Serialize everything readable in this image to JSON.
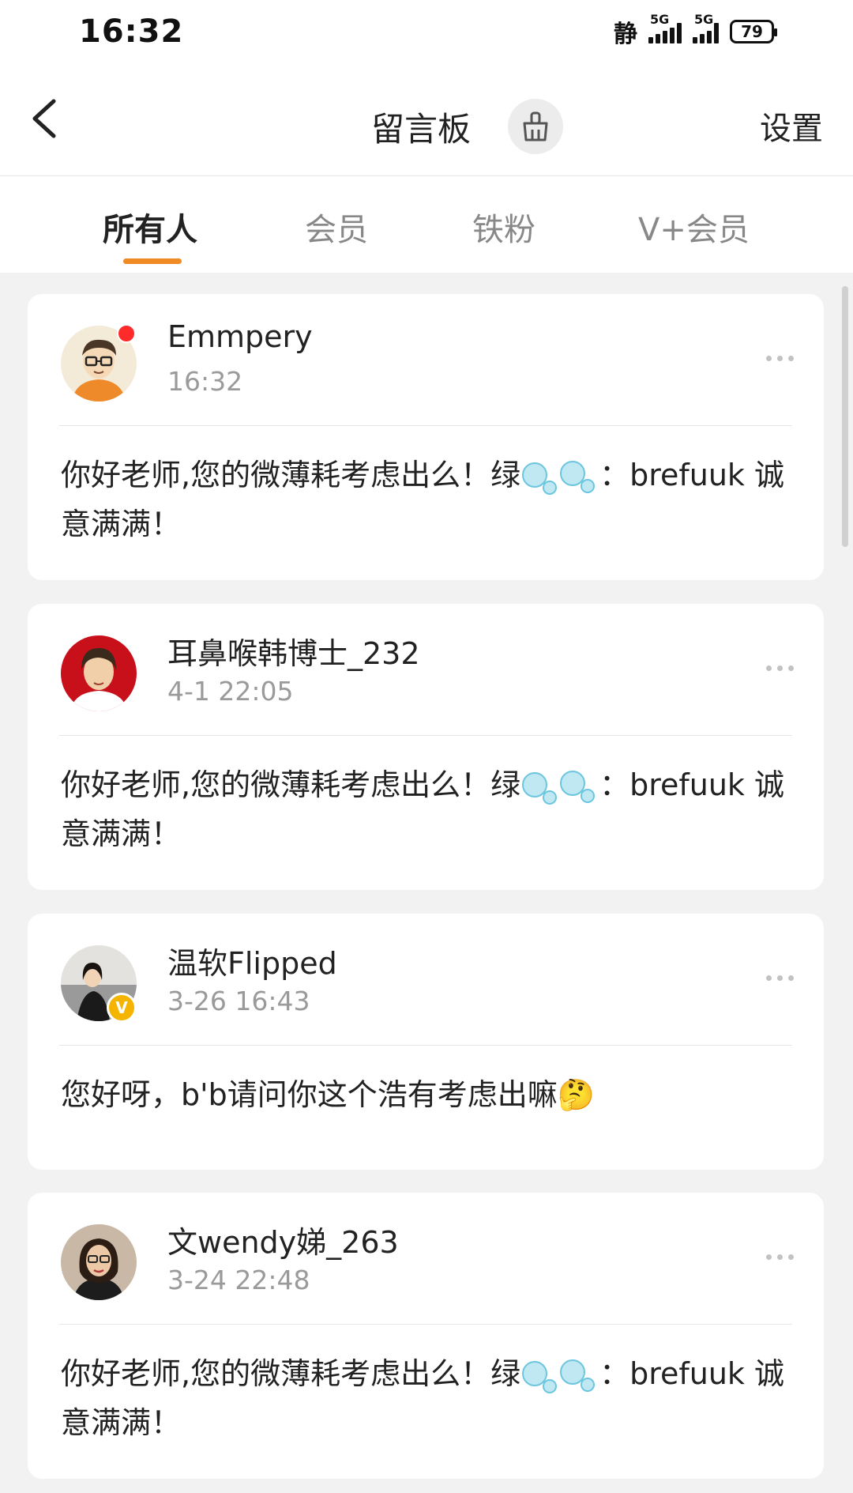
{
  "status_bar": {
    "time": "16:32",
    "mute_label": "静",
    "network1": "5G",
    "network2": "5G",
    "battery": "79"
  },
  "nav": {
    "title": "留言板",
    "settings_label": "设置",
    "back_icon": "chevron-left-icon",
    "clean_icon": "broom-icon"
  },
  "tabs": [
    {
      "label": "所有人",
      "active": true
    },
    {
      "label": "会员",
      "active": false
    },
    {
      "label": "铁粉",
      "active": false
    },
    {
      "label": "V+会员",
      "active": false
    }
  ],
  "accent_color": "#f08a24",
  "messages": [
    {
      "username": "Emmpery",
      "time": "16:32",
      "text_before": "你好老师,您的微薄耗考虑出么！绿",
      "text_after": "：brefuuk 诚意满满！"
    },
    {
      "username": "耳鼻喉韩博士_232",
      "time": "4-1 22:05",
      "text_before": "你好老师,您的微薄耗考虑出么！绿",
      "text_after": "：brefuuk  诚意满满！"
    },
    {
      "username": "温软Flipped",
      "time": "3-26 16:43",
      "text_before": "您好呀，b'b请问你这个浩有考虑出嘛",
      "text_after": "🤔",
      "vip_badge": "V"
    },
    {
      "username": "文wendy娣_263",
      "time": "3-24 22:48",
      "text_before": "你好老师,您的微薄耗考虑出么！绿",
      "text_after": "：brefuuk 诚意满满！"
    }
  ]
}
